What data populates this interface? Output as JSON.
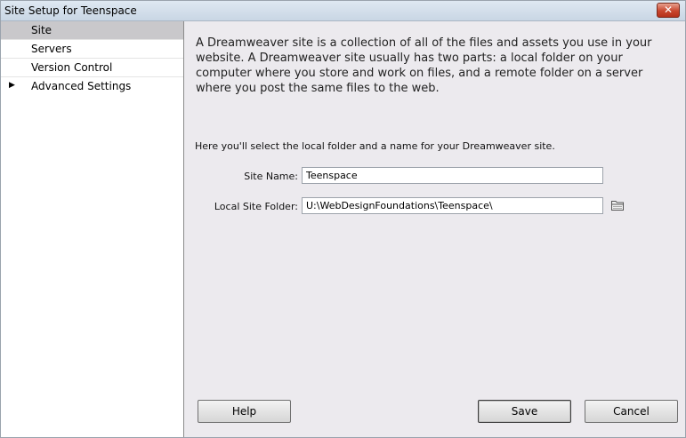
{
  "window": {
    "title": "Site Setup for Teenspace",
    "close_icon": "close-icon"
  },
  "sidebar": {
    "items": [
      {
        "label": "Site",
        "selected": true,
        "has_arrow": false
      },
      {
        "label": "Servers",
        "selected": false,
        "has_arrow": false
      },
      {
        "label": "Version Control",
        "selected": false,
        "has_arrow": false
      },
      {
        "label": "Advanced Settings",
        "selected": false,
        "has_arrow": true,
        "arrow": "▶"
      }
    ]
  },
  "main": {
    "intro": "A Dreamweaver site is a collection of all of the files and assets you use in your website. A Dreamweaver site usually has two parts: a local folder on your computer where you store and work on files, and a remote folder on a server where you post the same files to the web.",
    "instructions": "Here you'll select the local folder and a name for your Dreamweaver site.",
    "site_name": {
      "label": "Site Name:",
      "value": "Teenspace"
    },
    "local_folder": {
      "label": "Local Site Folder:",
      "value": "U:\\WebDesignFoundations\\Teenspace\\",
      "browse_icon": "folder-icon"
    }
  },
  "buttons": {
    "help": "Help",
    "save": "Save",
    "cancel": "Cancel"
  },
  "colors": {
    "close_button": "#c8462e",
    "selected_item": "#c9c8cb",
    "panel_background": "#eceaee"
  }
}
